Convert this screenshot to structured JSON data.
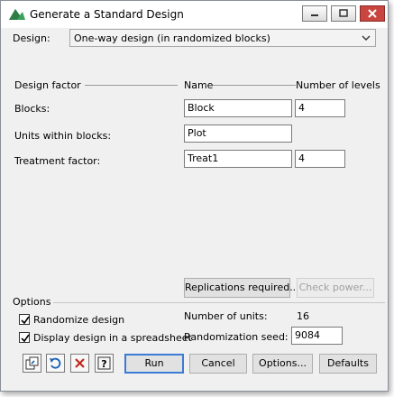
{
  "window": {
    "title": "Generate a Standard Design"
  },
  "design": {
    "label": "Design:",
    "selected": "One-way design (in randomized blocks)"
  },
  "headers": {
    "factor": "Design factor",
    "name": "Name",
    "levels": "Number of levels"
  },
  "rows": [
    {
      "label": "Blocks:",
      "name": "Block",
      "levels": "4"
    },
    {
      "label": "Units within blocks:",
      "name": "Plot"
    },
    {
      "label": "Treatment factor:",
      "name": "Treat1",
      "levels": "4"
    }
  ],
  "buttons": {
    "replications": "Replications required...",
    "check_power": "Check power...",
    "run": "Run",
    "cancel": "Cancel",
    "options": "Options...",
    "defaults": "Defaults"
  },
  "options": {
    "title": "Options",
    "randomize": {
      "label": "Randomize design",
      "checked": true
    },
    "spreadsheet": {
      "label": "Display design in a spreadsheet",
      "checked": true
    },
    "units_label": "Number of units:",
    "units_value": "16",
    "seed_label": "Randomization seed:",
    "seed_value": "9084"
  },
  "icons": [
    "copy-to-input-icon",
    "restore-icon",
    "clear-icon",
    "help-icon"
  ],
  "colors": {
    "accent": "#3a7bd5",
    "close": "#c8463f",
    "logo": "#3aa05a"
  }
}
